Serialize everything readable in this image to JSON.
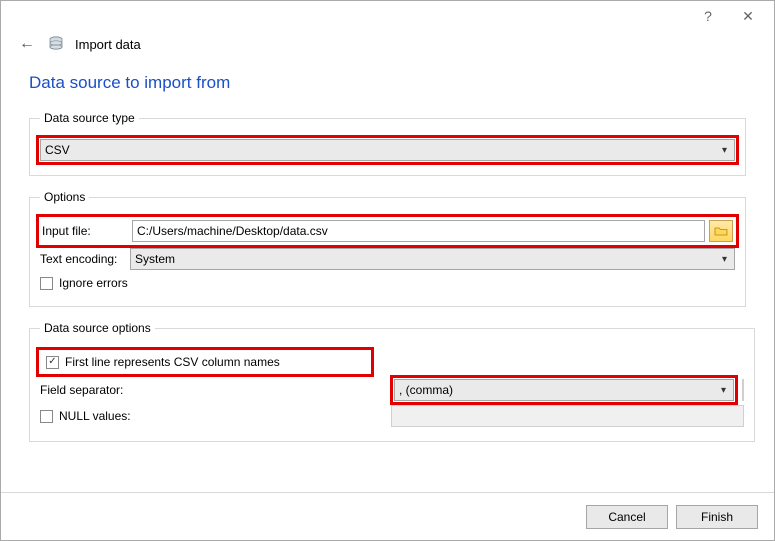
{
  "titlebar": {
    "help": "?",
    "close": "✕"
  },
  "header": {
    "back": "←",
    "title": "Import data"
  },
  "page": {
    "heading": "Data source to import from"
  },
  "group_source": {
    "legend": "Data source type",
    "value": "CSV"
  },
  "group_options": {
    "legend": "Options",
    "input_file_label": "Input file:",
    "input_file_value": "C:/Users/machine/Desktop/data.csv",
    "text_encoding_label": "Text encoding:",
    "text_encoding_value": "System",
    "ignore_errors_label": "Ignore errors"
  },
  "group_ds_options": {
    "legend": "Data source options",
    "first_line_label": "First line represents CSV column names",
    "field_separator_label": "Field separator:",
    "field_separator_value": ", (comma)",
    "null_values_label": "NULL values:"
  },
  "footer": {
    "cancel": "Cancel",
    "finish": "Finish"
  }
}
